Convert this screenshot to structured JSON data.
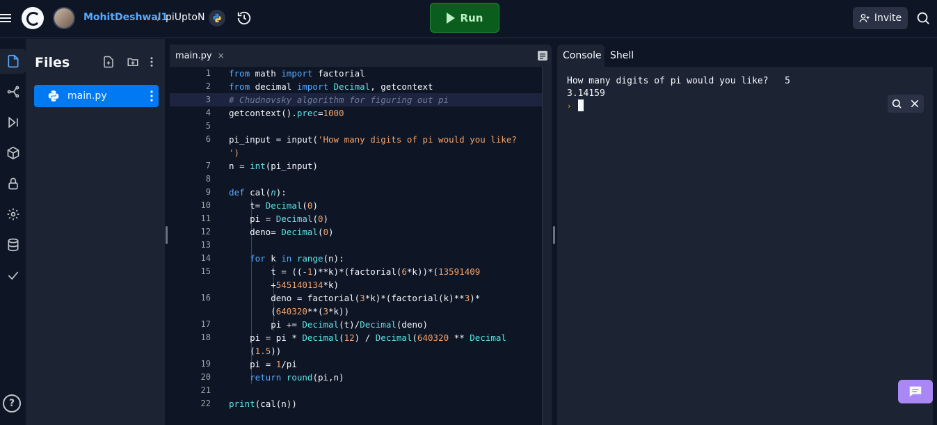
{
  "topbar": {
    "username": "MohitDeshwal1",
    "separator": "/",
    "repl_name": "piUptoN",
    "language_badge": "py",
    "run_label": "Run",
    "invite_label": "Invite"
  },
  "files": {
    "title": "Files",
    "items": [
      {
        "name": "main.py"
      }
    ]
  },
  "editor": {
    "tab_label": "main.py",
    "tab_close": "×"
  },
  "console": {
    "tabs": [
      "Console",
      "Shell"
    ],
    "output": [
      "How many digits of pi would you like?   5",
      "3.14159"
    ],
    "prompt": "›"
  },
  "help_label": "?",
  "colors": {
    "background": "#0e1525",
    "panel": "#1c2333",
    "accent_blue": "#0079f2",
    "run_green": "#0b5d1e",
    "chat_purple": "#a988f5"
  }
}
